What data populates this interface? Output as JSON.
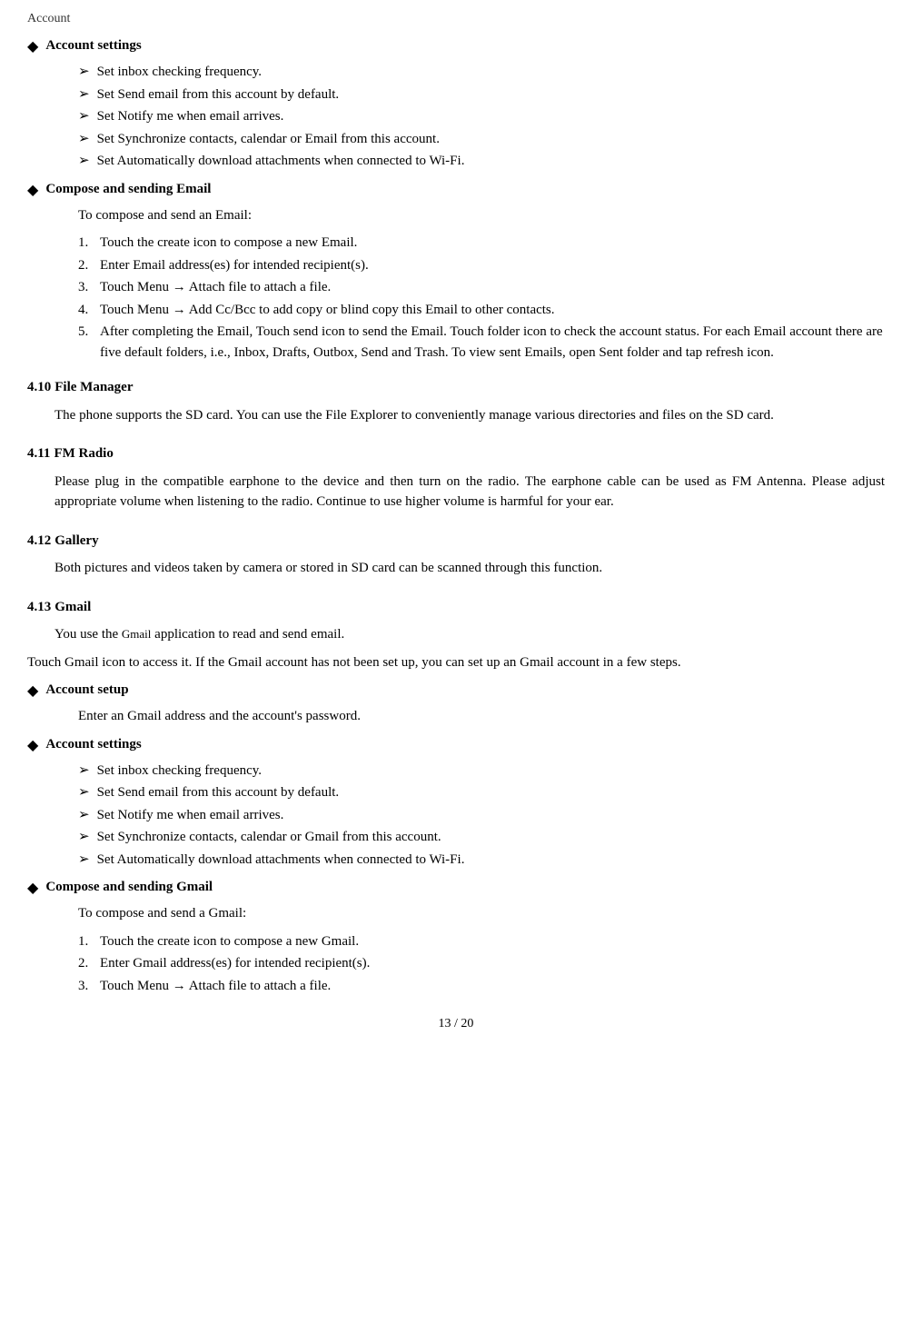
{
  "page": {
    "top_label": "Account",
    "footer": "13 / 20"
  },
  "sections": [
    {
      "type": "bullet-section",
      "title": "Account settings",
      "items": [
        "Set inbox checking frequency.",
        "Set Send email from this account by default.",
        "Set Notify me when email arrives.",
        "Set Synchronize contacts, calendar or Email from this account.",
        "Set Automatically download attachments when connected to Wi-Fi."
      ]
    },
    {
      "type": "bullet-section",
      "title": "Compose and sending Email",
      "intro": "To compose and send an Email:",
      "numbered": [
        "Touch the create icon to compose a new Email.",
        "Enter Email address(es) for intended recipient(s).",
        "Touch Menu  →  Attach file to attach a file.",
        "Touch Menu  →  Add Cc/Bcc to add copy or blind copy this Email to other contacts.",
        "After completing the Email, Touch send icon to send the Email. Touch folder icon to check the account status. For each Email account there are five default folders, i.e., Inbox, Drafts, Outbox, Send and Trash. To view sent Emails, open Sent folder and tap refresh icon."
      ]
    },
    {
      "type": "heading",
      "number": "4.10",
      "title": "File Manager",
      "para": "The phone supports the SD card. You can use the File Explorer to conveniently manage various directories and files on the SD card."
    },
    {
      "type": "heading",
      "number": "4.11",
      "title": "FM Radio",
      "para": "Please plug in the compatible earphone to the device and then turn on the radio. The earphone cable can be used as FM Antenna. Please adjust appropriate volume when listening to the radio. Continue to use higher volume is harmful for your ear."
    },
    {
      "type": "heading",
      "number": "4.12",
      "title": "Gallery",
      "para": "Both pictures and videos taken by camera or stored in SD card can be scanned through this function."
    },
    {
      "type": "heading",
      "number": "4.13",
      "title": "Gmail",
      "paras": [
        "You use the Gmail application to read and send email.",
        "Touch Gmail icon to access it. If the Gmail account has not been set up, you can set up an Gmail account in a few steps."
      ]
    },
    {
      "type": "bullet-section",
      "title": "Account setup",
      "intro": "Enter an Gmail address and the account's password."
    },
    {
      "type": "bullet-section",
      "title": "Account settings",
      "items": [
        "Set inbox checking frequency.",
        "Set Send email from this account by default.",
        "Set Notify me when email arrives.",
        "Set Synchronize contacts, calendar or Gmail from this account.",
        "Set Automatically download attachments when connected to Wi-Fi."
      ]
    },
    {
      "type": "bullet-section",
      "title": "Compose and sending Gmail",
      "intro": "To compose and send a Gmail:",
      "numbered": [
        "Touch the create icon to compose a new Gmail.",
        "Enter Gmail address(es) for intended recipient(s).",
        "Touch Menu  →  Attach file to attach a file."
      ]
    }
  ]
}
